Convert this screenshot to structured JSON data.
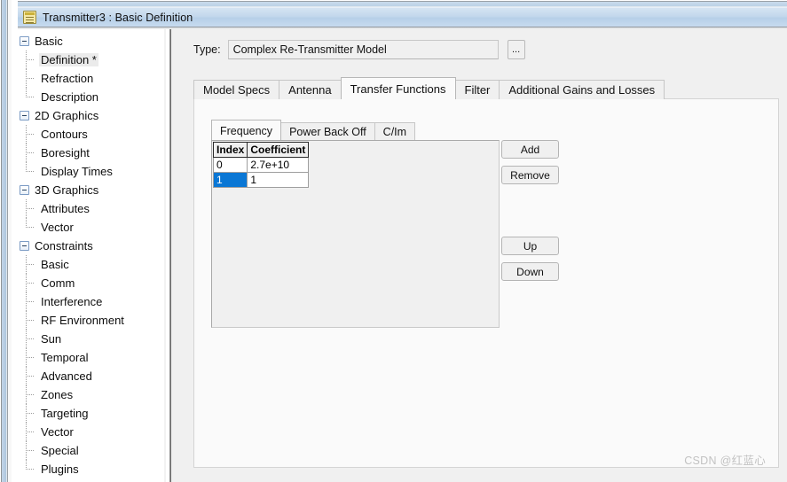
{
  "window": {
    "title": "Transmitter3 : Basic Definition",
    "icon": "document-properties-icon"
  },
  "tree": {
    "groups": [
      {
        "label": "Basic",
        "children": [
          {
            "label": "Definition *",
            "selected": true
          },
          {
            "label": "Refraction",
            "selected": false
          },
          {
            "label": "Description",
            "selected": false
          }
        ]
      },
      {
        "label": "2D Graphics",
        "children": [
          {
            "label": "Contours",
            "selected": false
          },
          {
            "label": "Boresight",
            "selected": false
          },
          {
            "label": "Display Times",
            "selected": false
          }
        ]
      },
      {
        "label": "3D Graphics",
        "children": [
          {
            "label": "Attributes",
            "selected": false
          },
          {
            "label": "Vector",
            "selected": false
          }
        ]
      },
      {
        "label": "Constraints",
        "children": [
          {
            "label": "Basic",
            "selected": false
          },
          {
            "label": "Comm",
            "selected": false
          },
          {
            "label": "Interference",
            "selected": false
          },
          {
            "label": "RF Environment",
            "selected": false
          },
          {
            "label": "Sun",
            "selected": false
          },
          {
            "label": "Temporal",
            "selected": false
          },
          {
            "label": "Advanced",
            "selected": false
          },
          {
            "label": "Zones",
            "selected": false
          },
          {
            "label": "Targeting",
            "selected": false
          },
          {
            "label": "Vector",
            "selected": false
          },
          {
            "label": "Special",
            "selected": false
          },
          {
            "label": "Plugins",
            "selected": false
          }
        ]
      }
    ]
  },
  "type_field": {
    "label": "Type:",
    "value": "Complex Re-Transmitter Model",
    "placeholder": "",
    "browse_label": "..."
  },
  "tabs": {
    "items": [
      {
        "label": "Model Specs",
        "active": false
      },
      {
        "label": "Antenna",
        "active": false
      },
      {
        "label": "Transfer Functions",
        "active": true
      },
      {
        "label": "Filter",
        "active": false
      },
      {
        "label": "Additional Gains and Losses",
        "active": false
      }
    ]
  },
  "inner_tabs": {
    "items": [
      {
        "label": "Frequency",
        "active": true
      },
      {
        "label": "Power Back Off",
        "active": false
      },
      {
        "label": "C/Im",
        "active": false
      }
    ]
  },
  "grid": {
    "columns": [
      "Index",
      "Coefficient"
    ],
    "rows": [
      {
        "index": "0",
        "coefficient": "2.7e+10",
        "selected": false
      },
      {
        "index": "1",
        "coefficient": "1",
        "selected": true
      }
    ]
  },
  "buttons": {
    "add": "Add",
    "remove": "Remove",
    "up": "Up",
    "down": "Down"
  },
  "watermark": {
    "text": "CSDN @红蓝心"
  },
  "colors": {
    "selection": "#0a77d5",
    "titlebar": "#c3d7ec",
    "panel": "#f0f0f0",
    "tab_active": "#fafafa"
  }
}
